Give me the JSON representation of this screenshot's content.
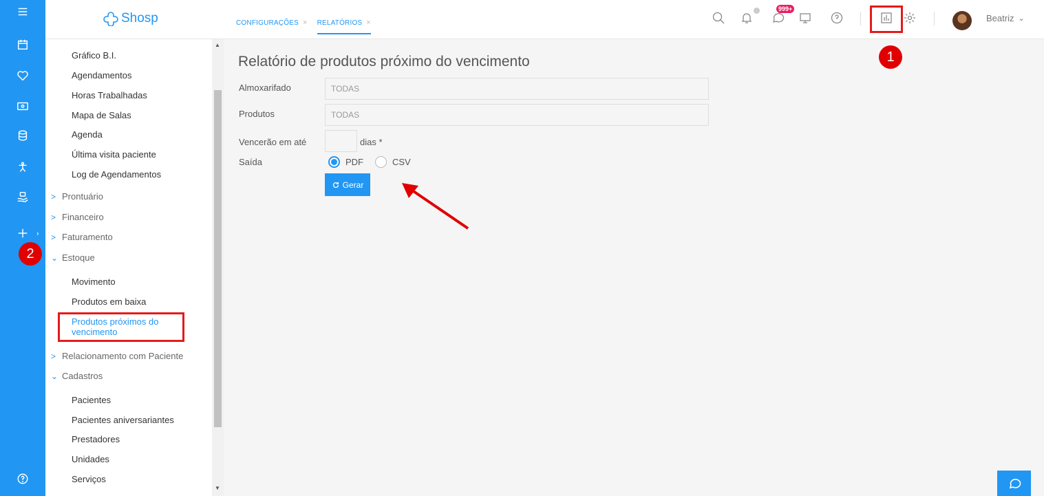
{
  "brand": {
    "logo_text": "Shosp"
  },
  "colors": {
    "primary": "#2196f3",
    "annotation": "#e21b1b",
    "badge": "#e91e63"
  },
  "tabs": [
    {
      "label": "CONFIGURAÇÕES",
      "close": "×"
    },
    {
      "label": "RELATÓRIOS",
      "close": "×"
    }
  ],
  "header": {
    "messages_badge": "999+",
    "user_name": "Beatriz",
    "user_chevron": "⌄"
  },
  "rail_icons": [
    "menu-icon",
    "calendar-icon",
    "heart-icon",
    "money-icon",
    "database-icon",
    "accessibility-icon",
    "hand-care-icon",
    "plus-icon",
    "help-icon"
  ],
  "sidebar": {
    "items_top": [
      "Gráfico B.I.",
      "Agendamentos",
      "Horas Trabalhadas",
      "Mapa de Salas",
      "Agenda",
      "Última visita paciente",
      "Log de Agendamentos"
    ],
    "sections": [
      {
        "label": "Prontuário",
        "chev": ">"
      },
      {
        "label": "Financeiro",
        "chev": ">"
      },
      {
        "label": "Faturamento",
        "chev": ">"
      },
      {
        "label": "Estoque",
        "chev": "⌄"
      }
    ],
    "estoque_items": [
      "Movimento",
      "Produtos em baixa",
      "Produtos próximos do vencimento"
    ],
    "sections_after": [
      {
        "label": "Relacionamento com Paciente",
        "chev": ">"
      },
      {
        "label": "Cadastros",
        "chev": "⌄"
      }
    ],
    "cadastros_items": [
      "Pacientes",
      "Pacientes aniversariantes",
      "Prestadores",
      "Unidades",
      "Serviços"
    ]
  },
  "form": {
    "title": "Relatório de produtos próximo do vencimento",
    "almoxarifado_label": "Almoxarifado",
    "almoxarifado_value": "TODAS",
    "produtos_label": "Produtos",
    "produtos_value": "TODAS",
    "vencerao_label": "Vencerão em até",
    "days_value": "",
    "days_suffix": "dias *",
    "saida_label": "Saída",
    "output_options": [
      "PDF",
      "CSV"
    ],
    "output_selected": "PDF",
    "generate_label": "Gerar"
  },
  "annotations": {
    "marker_1": "1",
    "marker_2": "2"
  }
}
